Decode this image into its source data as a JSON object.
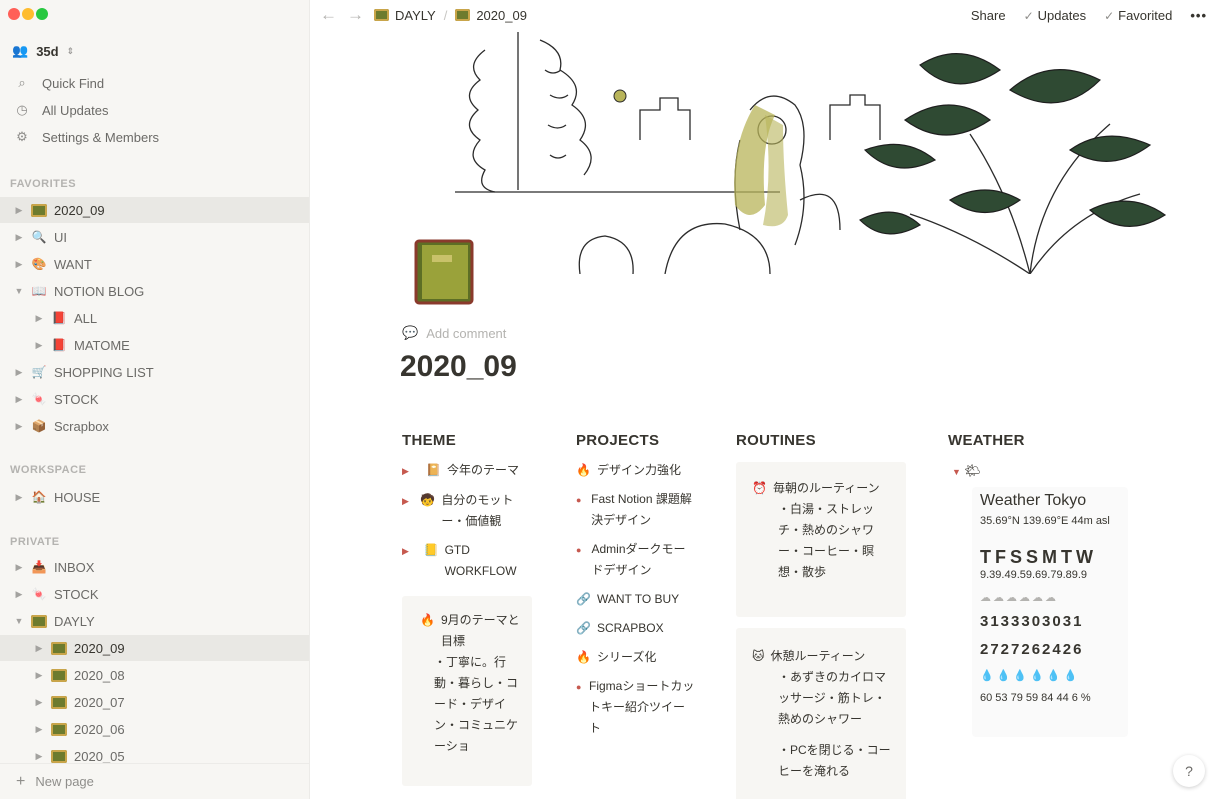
{
  "sidebar": {
    "traffic_lights": [
      "#ff5f57",
      "#febc2e",
      "#28c840"
    ],
    "workspace_name": "35d",
    "nav": [
      {
        "label": "Quick Find",
        "icon": "search-icon"
      },
      {
        "label": "All Updates",
        "icon": "clock-icon"
      },
      {
        "label": "Settings & Members",
        "icon": "gear-icon"
      }
    ],
    "favorites_label": "FAVORITES",
    "favorites": [
      {
        "label": "2020_09",
        "icon": "folder",
        "toggle": "▶",
        "depth": 0,
        "selected": true
      },
      {
        "label": "UI",
        "icon": "🔍",
        "toggle": "▶",
        "depth": 0
      },
      {
        "label": "WANT",
        "icon": "🎨",
        "toggle": "▶",
        "depth": 0
      },
      {
        "label": "NOTION BLOG",
        "icon": "📖",
        "toggle": "▼",
        "depth": 0
      },
      {
        "label": "ALL",
        "icon": "📕",
        "toggle": "▶",
        "depth": 1
      },
      {
        "label": "MATOME",
        "icon": "📕",
        "toggle": "▶",
        "depth": 1
      },
      {
        "label": "SHOPPING LIST",
        "icon": "🛒",
        "toggle": "▶",
        "depth": 0
      },
      {
        "label": "STOCK",
        "icon": "🍬",
        "toggle": "▶",
        "depth": 0
      },
      {
        "label": "Scrapbox",
        "icon": "📦",
        "toggle": "▶",
        "depth": 0
      }
    ],
    "workspace_label": "WORKSPACE",
    "workspace": [
      {
        "label": "HOUSE",
        "icon": "🏠",
        "toggle": "▶",
        "depth": 0
      }
    ],
    "private_label": "PRIVATE",
    "private": [
      {
        "label": "INBOX",
        "icon": "📥",
        "toggle": "▶",
        "depth": 0
      },
      {
        "label": "STOCK",
        "icon": "🍬",
        "toggle": "▶",
        "depth": 0
      },
      {
        "label": "DAYLY",
        "icon": "folder",
        "toggle": "▼",
        "depth": 0
      },
      {
        "label": "2020_09",
        "icon": "folder",
        "toggle": "▶",
        "depth": 1,
        "selected": true
      },
      {
        "label": "2020_08",
        "icon": "folder",
        "toggle": "▶",
        "depth": 1
      },
      {
        "label": "2020_07",
        "icon": "folder",
        "toggle": "▶",
        "depth": 1
      },
      {
        "label": "2020_06",
        "icon": "folder",
        "toggle": "▶",
        "depth": 1
      },
      {
        "label": "2020_05",
        "icon": "folder",
        "toggle": "▶",
        "depth": 1
      }
    ],
    "new_page": "New page"
  },
  "topbar": {
    "breadcrumb": [
      "DAYLY",
      "2020_09"
    ],
    "share": "Share",
    "updates": "Updates",
    "favorited": "Favorited",
    "more": "•••"
  },
  "page": {
    "add_comment": "Add comment",
    "title": "2020_09"
  },
  "columns": {
    "theme": {
      "heading": "THEME",
      "items": [
        {
          "emoji": "📔",
          "text": "今年のテーマ"
        },
        {
          "emoji": "🧒",
          "text": "自分のモットー・価値観"
        },
        {
          "emoji": "📒",
          "text": "GTD WORKFLOW"
        }
      ],
      "card_title": "9月のテーマと目標",
      "card_emoji": "🔥",
      "card_lines": [
        "・丁寧に。行動・暮らし・コード・デザイン・コミュニケーショ"
      ]
    },
    "projects": {
      "heading": "PROJECTS",
      "items": [
        {
          "type": "toggle",
          "emoji": "🔥",
          "text": "デザイン力強化"
        },
        {
          "type": "bullet",
          "text": "Fast Notion 課題解決デザイン"
        },
        {
          "type": "bullet",
          "text": "Adminダークモードデザイン"
        },
        {
          "type": "plain",
          "emoji": "🔗",
          "text": "WANT TO BUY"
        },
        {
          "type": "plain",
          "emoji": "🔗",
          "text": "SCRAPBOX"
        },
        {
          "type": "toggle",
          "emoji": "🔥",
          "text": "シリーズ化"
        },
        {
          "type": "bullet",
          "text": "Figmaショートカットキー紹介ツイート"
        }
      ]
    },
    "routines": {
      "heading": "ROUTINES",
      "card1_emoji": "⏰",
      "card1_title": "毎朝のルーティーン",
      "card1_text": "・白湯・ストレッチ・熱めのシャワー・コーヒー・瞑想・散歩",
      "card2_emoji": "🐱",
      "card2_title": "休憩ルーティーン",
      "card2_text": "・あずきのカイロマッサージ・筋トレ・熱めのシャワー",
      "card2_text2": "・PCを閉じる・コーヒーを淹れる"
    },
    "weather": {
      "heading": "WEATHER",
      "title": "Weather Tokyo",
      "coords": "35.69°N 139.69°E 44m asl",
      "days": "TFSSMTW",
      "temps": "9.39.49.59.69.79.89.9",
      "row_hi": "3133303031",
      "row_lo": "2727262426",
      "humidity": "60 53 79 59 84 44 6 %"
    }
  },
  "help": "?"
}
